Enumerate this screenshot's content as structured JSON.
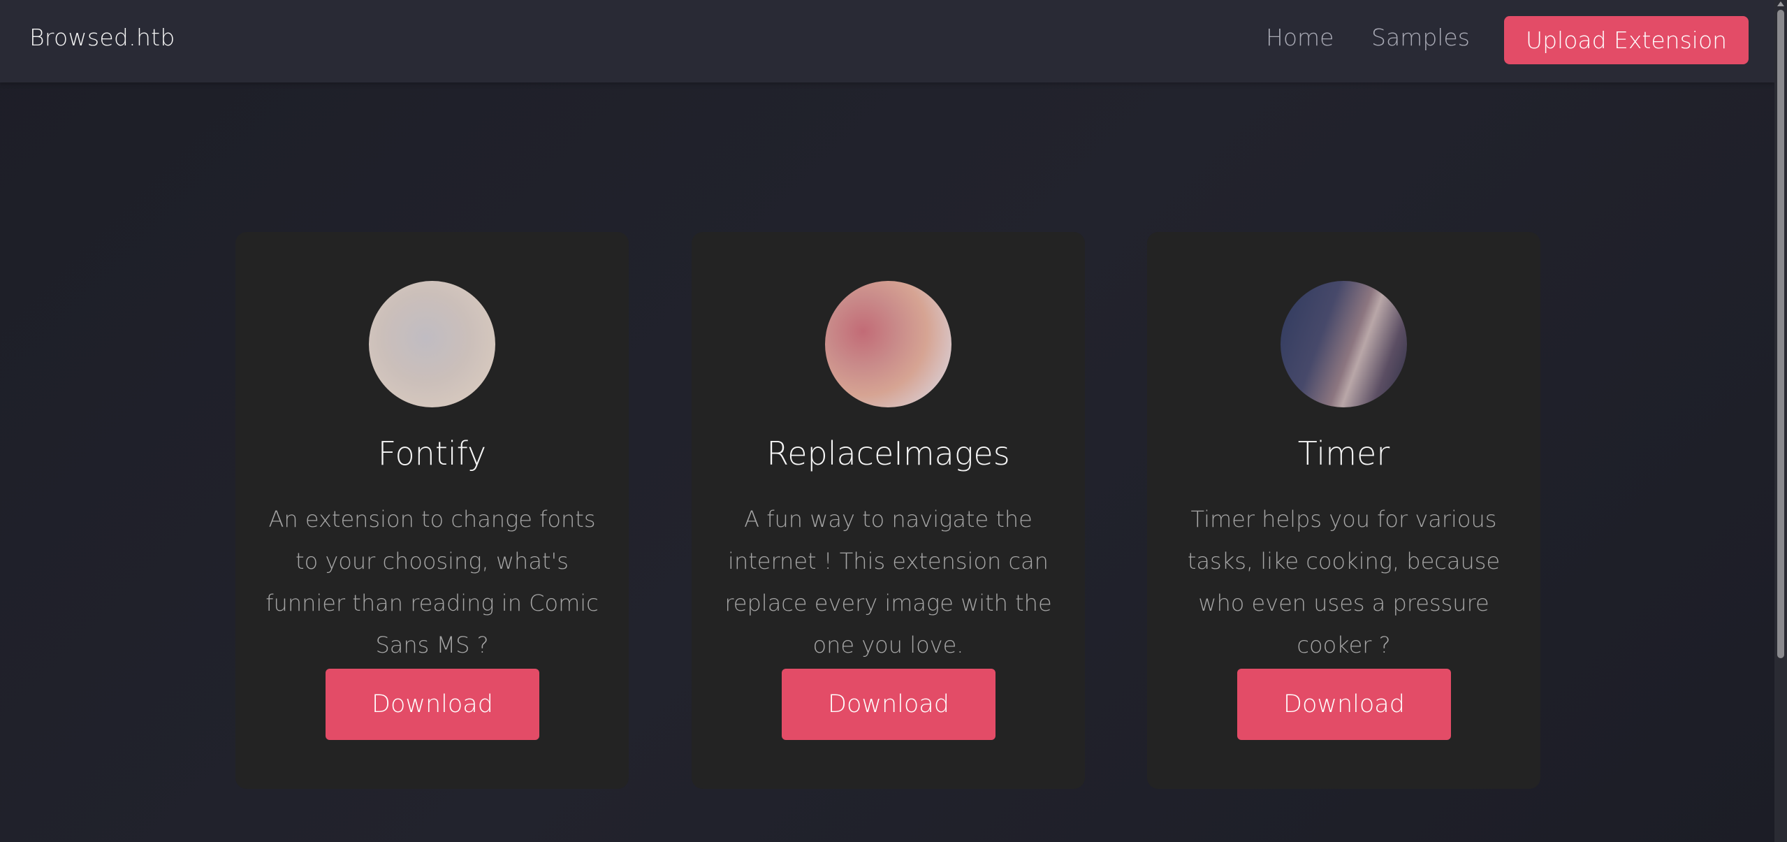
{
  "navbar": {
    "brand": "Browsed.htb",
    "links": [
      {
        "label": "Home"
      },
      {
        "label": "Samples"
      }
    ],
    "upload_label": "Upload Extension"
  },
  "cards": [
    {
      "title": "Fontify",
      "description": "An extension to change fonts to your choosing, what's funnier than reading in Comic Sans MS ?",
      "button_label": "Download"
    },
    {
      "title": "ReplaceImages",
      "description": "A fun way to navigate the internet ! This extension can replace every image with the one you love.",
      "button_label": "Download"
    },
    {
      "title": "Timer",
      "description": "Timer helps you for various tasks, like cooking, because who even uses a pressure cooker ?",
      "button_label": "Download"
    }
  ],
  "colors": {
    "accent": "#e34c67",
    "navbar_bg": "#292a35",
    "page_bg": "#1f2029",
    "card_bg": "#232323"
  }
}
